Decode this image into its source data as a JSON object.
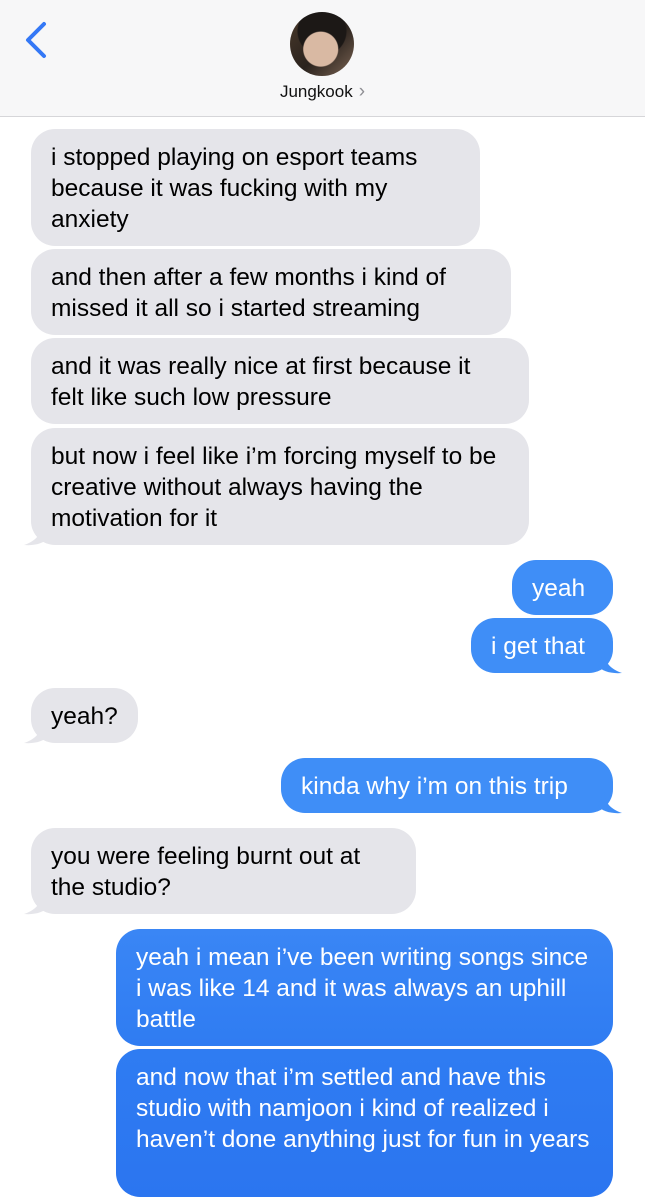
{
  "header": {
    "contact_name": "Jungkook",
    "chevron": "›",
    "back_icon": "chevron-left-icon",
    "accent_color": "#3478f6"
  },
  "messages": [
    {
      "from": "them",
      "text": "i stopped playing on esport teams because it was fucking with my anxiety"
    },
    {
      "from": "them",
      "text": "and then after a few months i kind of missed it all so i started streaming"
    },
    {
      "from": "them",
      "text": "and it was really nice at first because it felt like such low pressure"
    },
    {
      "from": "them",
      "text": "but now i feel like i’m forcing myself to be creative without always having the motivation for it"
    },
    {
      "from": "me",
      "text": "yeah"
    },
    {
      "from": "me",
      "text": "i get that"
    },
    {
      "from": "them",
      "text": "yeah?"
    },
    {
      "from": "me",
      "text": "kinda why i’m on this trip"
    },
    {
      "from": "them",
      "text": "you were feeling burnt out at the studio?"
    },
    {
      "from": "me",
      "text": "yeah i mean i’ve been writing songs since i was like 14 and it was always an uphill battle"
    },
    {
      "from": "me",
      "text": "and now that i’m settled and have this studio with namjoon i kind of realized i haven’t done anything just for fun in years"
    }
  ],
  "colors": {
    "incoming_bubble": "#e5e5ea",
    "outgoing_bubble": "#3f8ef7",
    "header_bg": "#f7f7f8"
  }
}
